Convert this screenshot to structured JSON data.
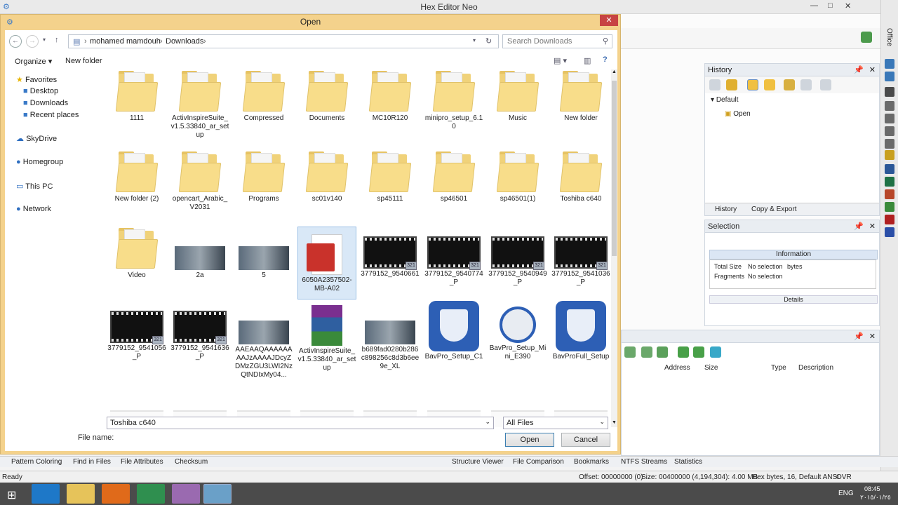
{
  "app": {
    "title": "Hex Editor Neo",
    "side_label": "Office"
  },
  "dialog": {
    "title": "Open",
    "close_label": "✕",
    "breadcrumb": [
      "mohamed mamdouh",
      "Downloads"
    ],
    "search_placeholder": "Search Downloads",
    "organize_label": "Organize ▾",
    "new_folder_label": "New folder",
    "nav": {
      "favorites": "Favorites",
      "favorite_items": [
        "Desktop",
        "Downloads",
        "Recent places"
      ],
      "skydrive": "SkyDrive",
      "homegroup": "Homegroup",
      "thispc": "This PC",
      "network": "Network"
    },
    "files": [
      {
        "name": "1111",
        "kind": "folder"
      },
      {
        "name": "ActivInspireSuite_v1.5.33840_ar_setup",
        "kind": "folder"
      },
      {
        "name": "Compressed",
        "kind": "folder"
      },
      {
        "name": "Documents",
        "kind": "folder"
      },
      {
        "name": "MC10R120",
        "kind": "folder"
      },
      {
        "name": "minipro_setup_6.10",
        "kind": "folder"
      },
      {
        "name": "Music",
        "kind": "folder"
      },
      {
        "name": "New folder",
        "kind": "folder"
      },
      {
        "name": "New folder (2)",
        "kind": "folder"
      },
      {
        "name": "opencart_Arabic_V2031",
        "kind": "folder"
      },
      {
        "name": "Programs",
        "kind": "folder"
      },
      {
        "name": "sc01v140",
        "kind": "folder"
      },
      {
        "name": "sp45111",
        "kind": "folder"
      },
      {
        "name": "sp46501",
        "kind": "folder"
      },
      {
        "name": "sp46501(1)",
        "kind": "folder"
      },
      {
        "name": "Toshiba c640",
        "kind": "folder"
      },
      {
        "name": "Video",
        "kind": "folder"
      },
      {
        "name": "2a",
        "kind": "image"
      },
      {
        "name": "5",
        "kind": "image"
      },
      {
        "name": "6050A2357502-MB-A02",
        "kind": "pdf"
      },
      {
        "name": "3779152_9540661",
        "kind": "video"
      },
      {
        "name": "3779152_9540774_P",
        "kind": "video"
      },
      {
        "name": "3779152_9540949_P",
        "kind": "video"
      },
      {
        "name": "3779152_9541036_P",
        "kind": "video"
      },
      {
        "name": "3779152_9541056_P",
        "kind": "video"
      },
      {
        "name": "3779152_9541636_P",
        "kind": "video"
      },
      {
        "name": "AAEAAQAAAAAAAAJzAAAAJDcyZDMzZGU3LWI2NzQtNDIxMy04...",
        "kind": "image"
      },
      {
        "name": "ActivInspireSuite_v1.5.33840_ar_setup",
        "kind": "rar"
      },
      {
        "name": "b689fad0280b286c898256c8d3b6ee9e_XL",
        "kind": "image"
      },
      {
        "name": "BavPro_Setup_C1",
        "kind": "shield"
      },
      {
        "name": "BavPro_Setup_Mini_E390",
        "kind": "globe"
      },
      {
        "name": "BavProFull_Setup",
        "kind": "shield"
      }
    ],
    "file_name_label": "File name:",
    "file_name_value": "Toshiba c640",
    "file_type_value": "All Files",
    "open_button": "Open",
    "cancel_button": "Cancel"
  },
  "history_panel": {
    "title": "History",
    "tree_root": "Default",
    "tree_child": "Open",
    "tab_history": "History",
    "tab_copy": "Copy & Export"
  },
  "selection_panel": {
    "title": "Selection",
    "info_header": "Information",
    "total_size_label": "Total Size",
    "total_size_value": "No selection",
    "total_size_unit": "bytes",
    "fragments_label": "Fragments",
    "fragments_value": "No selection",
    "details_label": "Details"
  },
  "bookmarks_panel": {
    "columns": [
      "Address",
      "Size",
      "Type",
      "Description"
    ]
  },
  "bottom_tabs": {
    "left": [
      "Pattern Coloring",
      "Find in Files",
      "File Attributes",
      "Checksum"
    ],
    "right": [
      "Structure Viewer",
      "File Comparison",
      "Bookmarks",
      "NTFS Streams",
      "Statistics"
    ]
  },
  "status": {
    "ready": "Ready",
    "offset": "Offset: 00000000 (0)",
    "size": "Size: 00400000 (4,194,304): 4.00 MB",
    "mode": "Hex bytes, 16, Default ANSI",
    "ovr": "OVR"
  },
  "taskbar": {
    "lang": "ENG",
    "time": "08:45",
    "date": "٢٠١٥/٠١/٢٥"
  }
}
